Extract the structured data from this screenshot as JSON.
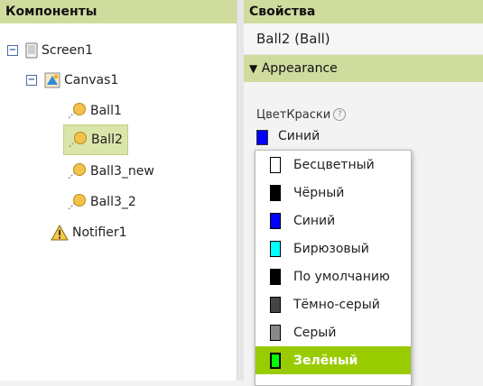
{
  "components": {
    "title": "Компоненты",
    "tree": [
      {
        "label": "Screen1",
        "icon": "screen-icon"
      },
      {
        "label": "Canvas1",
        "icon": "canvas-icon"
      },
      {
        "label": "Ball1",
        "icon": "ball-icon"
      },
      {
        "label": "Ball2",
        "icon": "ball-icon",
        "selected": true
      },
      {
        "label": "Ball3_new",
        "icon": "ball-icon"
      },
      {
        "label": "Ball3_2",
        "icon": "ball-icon"
      },
      {
        "label": "Notifier1",
        "icon": "warning-icon"
      }
    ]
  },
  "properties": {
    "title": "Свойства",
    "component": "Ball2 (Ball)",
    "section": "Appearance",
    "prop_label": "ЦветКраски",
    "help": "?",
    "current_value": "Синий",
    "current_color": "#0000ff"
  },
  "dropdown": {
    "options": [
      {
        "label": "Бесцветный",
        "color": "#ffffff"
      },
      {
        "label": "Чёрный",
        "color": "#000000"
      },
      {
        "label": "Синий",
        "color": "#0000ff"
      },
      {
        "label": "Бирюзовый",
        "color": "#00ffff"
      },
      {
        "label": "По умолчанию",
        "color": "#000000"
      },
      {
        "label": "Тёмно-серый",
        "color": "#444444"
      },
      {
        "label": "Серый",
        "color": "#888888"
      },
      {
        "label": "Зелёный",
        "color": "#00ff00",
        "highlighted": true
      }
    ]
  },
  "colors": {
    "accent": "#cfdc9e",
    "highlight": "#99cc00"
  }
}
